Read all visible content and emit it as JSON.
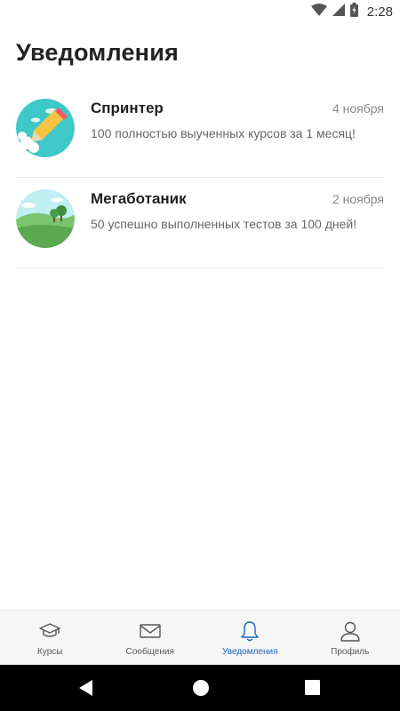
{
  "status_bar": {
    "time": "2:28"
  },
  "page": {
    "title": "Уведомления"
  },
  "notifications": [
    {
      "title": "Спринтер",
      "date": "4 ноября",
      "text": "100 полностью выученных курсов за 1 месяц!",
      "icon": "rocket-pencil-icon"
    },
    {
      "title": "Мегаботаник",
      "date": "2 ноября",
      "text": "50 успешно выполненных тестов за 100 дней!",
      "icon": "landscape-trees-icon"
    }
  ],
  "bottom_nav": [
    {
      "label": "Курсы",
      "icon": "graduation-cap-icon",
      "active": false
    },
    {
      "label": "Сообщения",
      "icon": "envelope-icon",
      "active": false
    },
    {
      "label": "Уведомления",
      "icon": "bell-icon",
      "active": true
    },
    {
      "label": "Профиль",
      "icon": "person-icon",
      "active": false
    }
  ],
  "colors": {
    "accent": "#1565c0",
    "icon_gray": "#555555"
  }
}
